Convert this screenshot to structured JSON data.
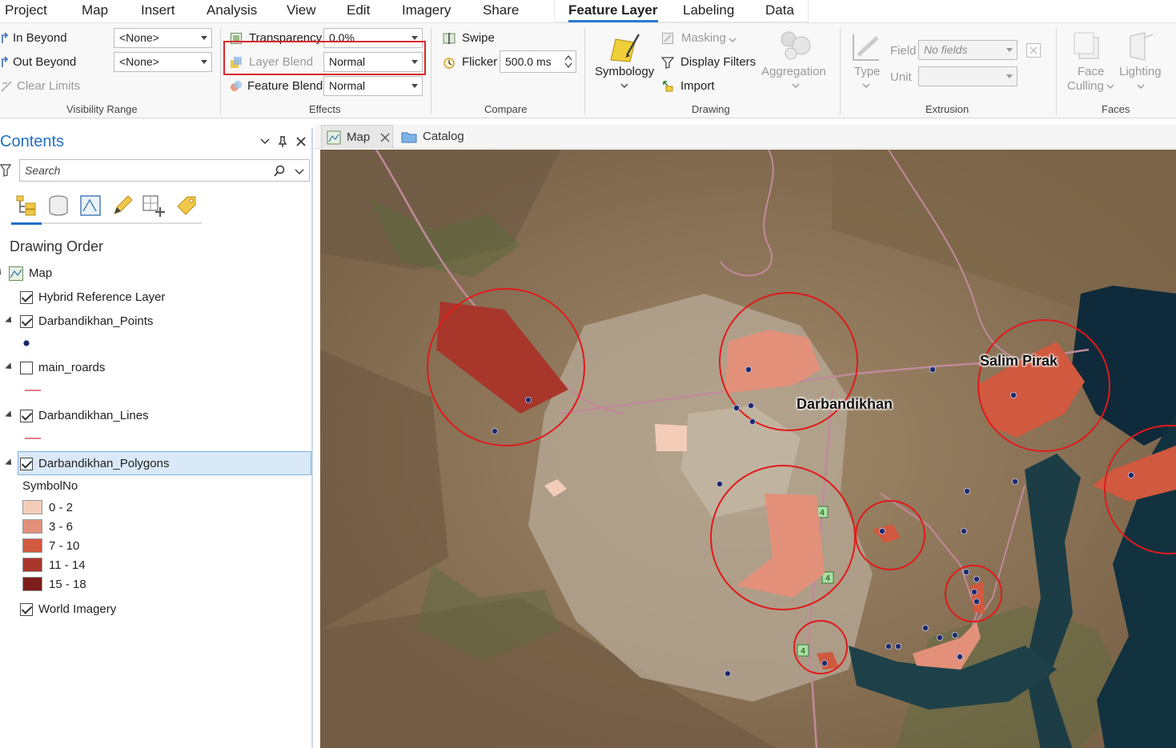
{
  "tabs": [
    "Project",
    "Map",
    "Insert",
    "Analysis",
    "View",
    "Edit",
    "Imagery",
    "Share",
    "Feature Layer",
    "Labeling",
    "Data"
  ],
  "active_tab": "Feature Layer",
  "ribbon": {
    "visibility": {
      "in_beyond": "In Beyond",
      "out_beyond": "Out Beyond",
      "clear_limits": "Clear Limits",
      "in_value": "<None>",
      "out_value": "<None>",
      "group_label": "Visibility Range"
    },
    "effects": {
      "transparency_label": "Transparency",
      "transparency_value": "0.0%",
      "layer_blend_label": "Layer Blend",
      "layer_blend_value": "Normal",
      "feature_blend_label": "Feature Blend",
      "feature_blend_value": "Normal",
      "group_label": "Effects"
    },
    "compare": {
      "swipe": "Swipe",
      "flicker": "Flicker",
      "flicker_value": "500.0",
      "flicker_unit": "ms",
      "group_label": "Compare"
    },
    "drawing": {
      "symbology": "Symbology",
      "masking": "Masking",
      "display_filters": "Display Filters",
      "import": "Import",
      "aggregation": "Aggregation",
      "group_label": "Drawing"
    },
    "extrusion": {
      "type": "Type",
      "field_label": "Field",
      "field_value": "No fields",
      "unit_label": "Unit",
      "group_label": "Extrusion"
    },
    "faces": {
      "face_culling_1": "Face",
      "face_culling_2": "Culling",
      "lighting": "Lighting",
      "group_label": "Faces"
    }
  },
  "contents": {
    "title": "Contents",
    "search_placeholder": "Search",
    "drawing_order": "Drawing Order",
    "map": "Map",
    "layers": [
      {
        "name": "Hybrid Reference Layer",
        "checked": true
      },
      {
        "name": "Darbandikhan_Points",
        "checked": true
      },
      {
        "name": "main_roards",
        "checked": false
      },
      {
        "name": "Darbandikhan_Lines",
        "checked": true
      },
      {
        "name": "Darbandikhan_Polygons",
        "checked": true
      },
      {
        "name": "World Imagery",
        "checked": true
      }
    ],
    "legend_field": "SymbolNo",
    "legend": [
      {
        "label": "0 - 2",
        "color": "#f4cdb9"
      },
      {
        "label": "3 - 6",
        "color": "#e2907a"
      },
      {
        "label": "7 - 10",
        "color": "#d0593f"
      },
      {
        "label": "11 - 14",
        "color": "#a8362a"
      },
      {
        "label": "15 - 18",
        "color": "#7d1d1a"
      }
    ]
  },
  "map_tabs": {
    "map": "Map",
    "catalog": "Catalog"
  },
  "map": {
    "labels": {
      "salim_pirak": "Salim Pirak",
      "darbandikhan": "Darbandikhan"
    },
    "road_shields": [
      "4",
      "4",
      "4"
    ]
  },
  "colors": {
    "accent": "#1f6fc5",
    "highlight_red": "#d9262b",
    "point": "#1f2a6b",
    "line": "#e07c8a"
  }
}
